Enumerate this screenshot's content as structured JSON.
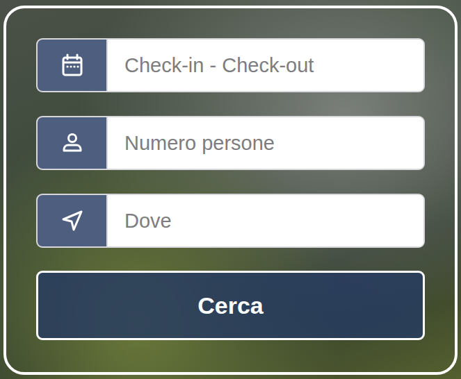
{
  "fields": [
    {
      "kind": "dates",
      "placeholder": "Check-in - Check-out"
    },
    {
      "kind": "guests",
      "placeholder": "Numero persone"
    },
    {
      "kind": "location",
      "placeholder": "Dove"
    }
  ],
  "search_button": {
    "label": "Cerca"
  }
}
